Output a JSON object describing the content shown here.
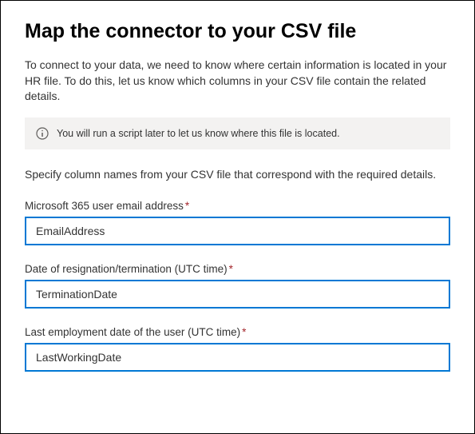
{
  "title": "Map the connector to your CSV file",
  "intro": "To connect to your data, we need to know where certain information is located in your HR file. To do this, let us know which columns in your CSV file contain the related details.",
  "banner": {
    "text": "You will run a script later to let us know where this file is located."
  },
  "sectionText": "Specify column names from your CSV file that correspond with the required details.",
  "fields": [
    {
      "label": "Microsoft 365 user email address",
      "required": true,
      "value": "EmailAddress"
    },
    {
      "label": "Date of resignation/termination (UTC time)",
      "required": true,
      "value": "TerminationDate"
    },
    {
      "label": "Last employment date of the user (UTC time)",
      "required": true,
      "value": "LastWorkingDate"
    }
  ]
}
